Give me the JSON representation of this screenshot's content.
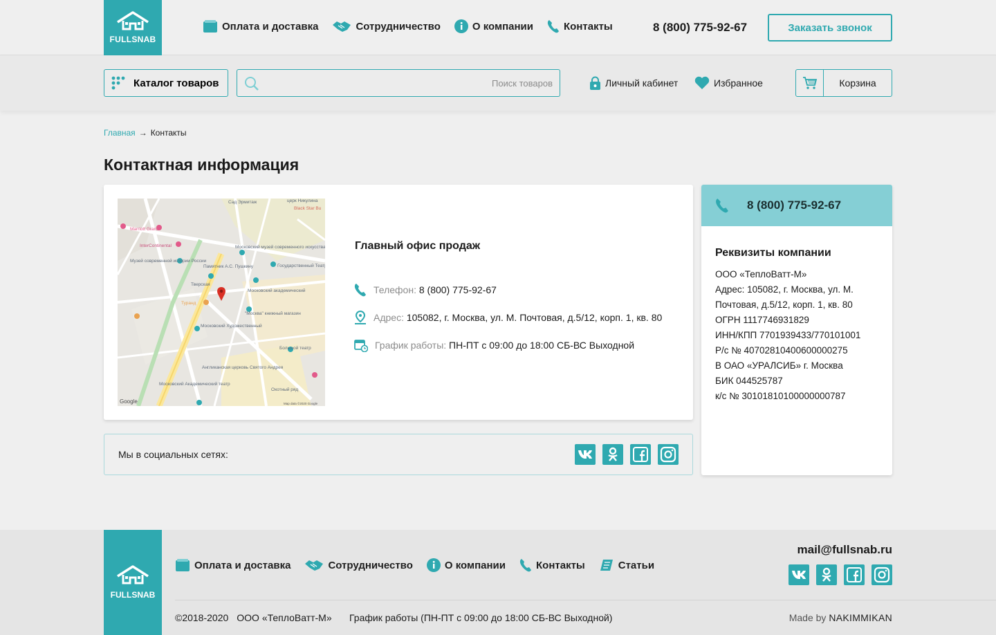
{
  "brand": {
    "name": "FULLSNAB"
  },
  "header": {
    "nav": [
      {
        "label": "Оплата и доставка",
        "icon": "wallet-icon"
      },
      {
        "label": "Сотрудничество",
        "icon": "handshake-icon"
      },
      {
        "label": "О компании",
        "icon": "info-icon"
      },
      {
        "label": "Контакты",
        "icon": "phone-icon"
      }
    ],
    "phone": "8 (800) 775-92-67",
    "callback_label": "Заказать звонок"
  },
  "toolbar": {
    "catalog_label": "Каталог товаров",
    "search_placeholder": "Поиск товаров",
    "cabinet_label": "Личный кабинет",
    "favorites_label": "Избранное",
    "cart_label": "Корзина"
  },
  "breadcrumb": {
    "home": "Главная",
    "arrow": "→",
    "current": "Контакты"
  },
  "page_title": "Контактная информация",
  "office": {
    "title": "Главный офис продаж",
    "phone_label": "Телефон:",
    "phone_value": "8 (800) 775-92-67",
    "address_label": "Адрес:",
    "address_value": "105082, г. Москва, ул. М. Почтовая, д.5/12, корп. 1, кв. 80",
    "hours_label": "График работы:",
    "hours_value": "ПН-ПТ с 09:00 до 18:00 СБ-ВС Выходной"
  },
  "map_labels": {
    "a": "Сад Эрмитаж",
    "b": "церк Никулина",
    "c": "Black Star Bu",
    "d": "Marriott Grand",
    "e": "InterContinental",
    "f": "Московский музей современного искусства",
    "g": "Музей современной истории России",
    "h": "Памятник А.С. Пушкину",
    "i": "Государственный Театр Наций",
    "j": "Тверская",
    "k": "Московский академический",
    "l": "Туранд",
    "m": "\"Москва\" книжный магазин",
    "n": "Московский Художественный",
    "o": "Большой театр",
    "p": "Англиканская церковь Святого Андрея",
    "q": "Московский Академический театр",
    "r": "Охотный ряд",
    "s": "Google",
    "t": "Map data ©2020 Google"
  },
  "social": {
    "label": "Мы в социальных сетях:",
    "items": [
      "vk-icon",
      "ok-icon",
      "facebook-icon",
      "instagram-icon"
    ]
  },
  "requisites": {
    "phone": "8 (800) 775-92-67",
    "title": "Реквизиты компании",
    "lines": [
      "ООО «ТеплоВатт-М»",
      "Адрес: 105082, г. Москва, ул. М.",
      "Почтовая, д.5/12, корп. 1, кв. 80",
      "ОГРН   1117746931829",
      "ИНН/КПП   7701939433/770101001",
      "Р/с № 40702810400600000275",
      "В ОАО «УРАЛСИБ»  г. Москва",
      "БИК 044525787",
      "к/с  № 30101810100000000787"
    ]
  },
  "footer": {
    "nav": [
      {
        "label": "Оплата и доставка",
        "icon": "wallet-icon"
      },
      {
        "label": "Сотрудничество",
        "icon": "handshake-icon"
      },
      {
        "label": "О компании",
        "icon": "info-icon"
      },
      {
        "label": "Контакты",
        "icon": "phone-icon"
      },
      {
        "label": "Статьи",
        "icon": "articles-icon"
      }
    ],
    "email": "mail@fullsnab.ru",
    "copyright": "©2018-2020",
    "company": "ООО «ТеплоВатт-М»",
    "hours": "График работы (ПН-ПТ с 09:00 до 18:00 СБ-ВС Выходной)",
    "made_by_prefix": "Made by",
    "made_by_name": "NAKIMMIKAN"
  },
  "colors": {
    "accent": "#2fa9b0",
    "accent_light": "#85cfd5",
    "background": "#efefef"
  }
}
